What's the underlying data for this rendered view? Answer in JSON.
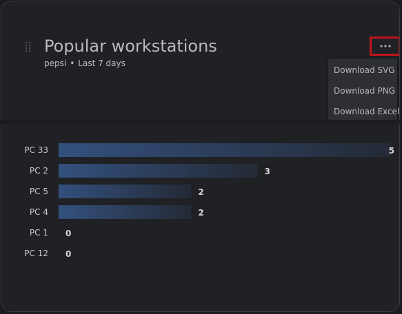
{
  "widget": {
    "title": "Popular workstations",
    "subtitle_org": "pepsi",
    "subtitle_separator": "•",
    "subtitle_range": "Last 7 days",
    "icons": {
      "drag": "drag-handle-icon",
      "more": "more-horizontal-icon"
    }
  },
  "menu": {
    "items": [
      {
        "label": "Download SVG"
      },
      {
        "label": "Download PNG"
      },
      {
        "label": "Download Excel"
      }
    ]
  },
  "chart_data": {
    "type": "bar",
    "orientation": "horizontal",
    "categories": [
      "PC 33",
      "PC 2",
      "PC 5",
      "PC 4",
      "PC 1",
      "PC 12"
    ],
    "values": [
      5,
      3,
      2,
      2,
      0,
      0
    ],
    "xlim": [
      0,
      5
    ],
    "grid": false,
    "colors": {
      "bar_start": "#33507d",
      "bar_end": "#242a36",
      "label": "#c8c9cd",
      "value": "#d6d7da"
    }
  }
}
